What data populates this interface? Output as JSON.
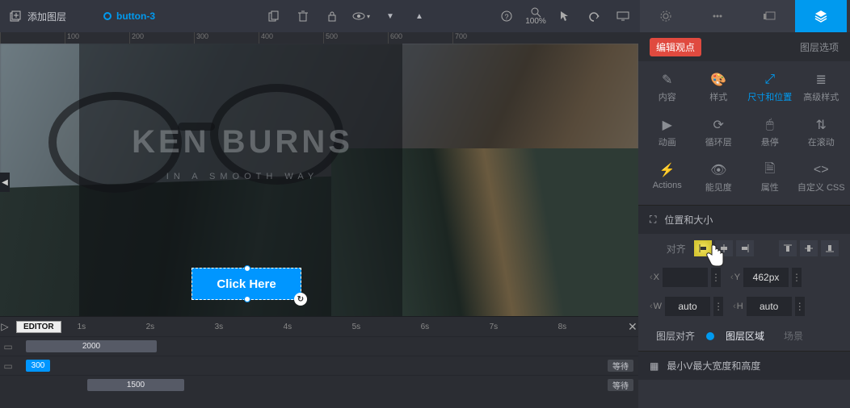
{
  "topbar": {
    "add_layer": "添加图层",
    "selected_layer": "button-3",
    "zoom": "100%"
  },
  "right_tabs": {
    "settings": "设置",
    "nav": "导航",
    "slide": "幻灯片",
    "layers": "图层"
  },
  "side_header": {
    "badge": "编辑观点",
    "options": "图层选项"
  },
  "toolgrid": {
    "content": "内容",
    "style": "样式",
    "size_pos": "尺寸和位置",
    "adv_style": "高级样式",
    "anim": "动画",
    "loop": "循环层",
    "hover": "悬停",
    "onscroll": "在滚动",
    "actions": "Actions",
    "visibility": "能见度",
    "attrs": "属性",
    "custom_css": "自定义 CSS"
  },
  "sections": {
    "pos_size": "位置和大小",
    "min_max": "最小V最大宽度和高度"
  },
  "form": {
    "align_label": "对齐",
    "x_label": "X",
    "x_value": "",
    "y_label": "Y",
    "y_value": "462px",
    "w_label": "W",
    "w_value": "auto",
    "h_label": "H",
    "h_value": "auto",
    "layer_align_label": "图层对齐",
    "layer_align_opt1": "图层区域",
    "layer_align_opt2": "场景"
  },
  "canvas": {
    "headline": "KEN BURNS",
    "subline": "IN A SMOOTH WAY",
    "button_text": "Click Here"
  },
  "timeline": {
    "editor": "EDITOR",
    "ticks": [
      "1s",
      "2s",
      "3s",
      "4s",
      "5s",
      "6s",
      "7s",
      "8s"
    ],
    "bar1": "2000",
    "bar2": "300",
    "bar3": "1500",
    "wait": "等待"
  }
}
